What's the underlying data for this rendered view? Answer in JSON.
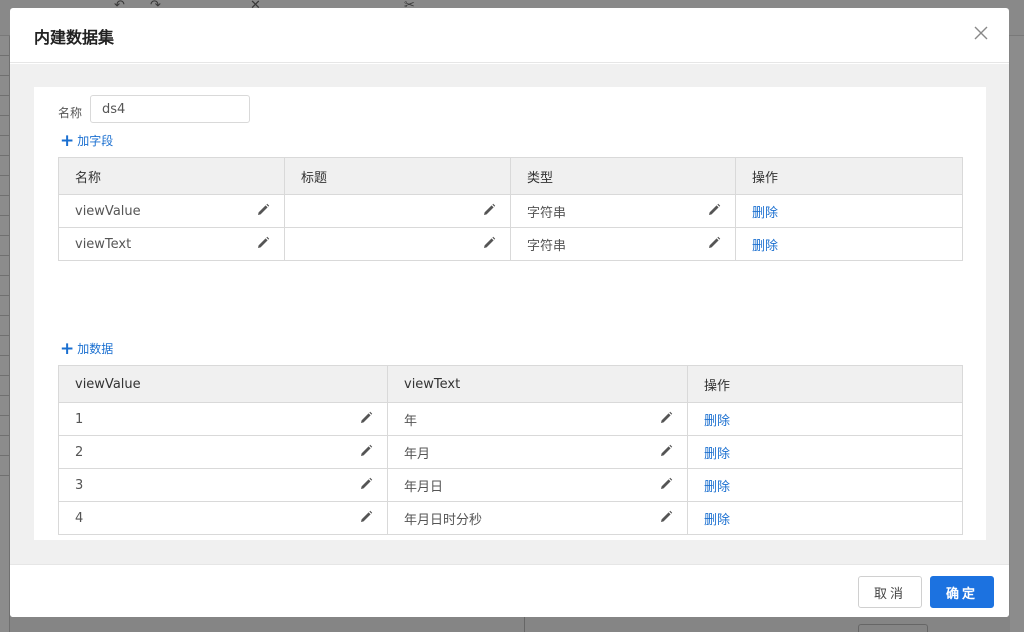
{
  "dialog": {
    "title": "内建数据集",
    "close_label": "X"
  },
  "name_field": {
    "label": "名称",
    "value": "ds4"
  },
  "fields_section": {
    "add_label": "加字段",
    "columns": [
      "名称",
      "标题",
      "类型",
      "操作"
    ],
    "rows": [
      {
        "name": "viewValue",
        "title": "",
        "type": "字符串",
        "action": "删除"
      },
      {
        "name": "viewText",
        "title": "",
        "type": "字符串",
        "action": "删除"
      }
    ]
  },
  "data_section": {
    "add_label": "加数据",
    "columns": [
      "viewValue",
      "viewText",
      "操作"
    ],
    "rows": [
      {
        "view_value": "1",
        "view_text": "年",
        "action": "删除"
      },
      {
        "view_value": "2",
        "view_text": "年月",
        "action": "删除"
      },
      {
        "view_value": "3",
        "view_text": "年月日",
        "action": "删除"
      },
      {
        "view_value": "4",
        "view_text": "年月日时分秒",
        "action": "删除"
      }
    ]
  },
  "footer": {
    "cancel_label": "取消",
    "ok_label": "确定"
  },
  "colors": {
    "accent": "#1c72e0",
    "link": "#1a6fd0",
    "header_bg": "#f0f0f0"
  }
}
